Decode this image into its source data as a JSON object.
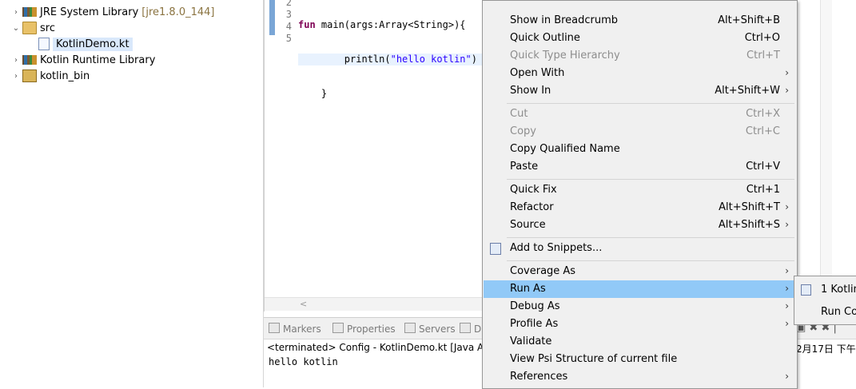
{
  "explorer": {
    "items": [
      {
        "label": "JRE System Library",
        "suffix": "[jre1.8.0_144]",
        "twisty": "›",
        "icon": "library-icon"
      },
      {
        "label": "src",
        "twisty": "⌄",
        "icon": "folder-icon"
      },
      {
        "label": "KotlinDemo.kt",
        "icon": "kotlin-file-icon",
        "selected": true
      },
      {
        "label": "Kotlin Runtime Library",
        "twisty": "›",
        "icon": "library-icon"
      },
      {
        "label": "kotlin_bin",
        "twisty": "›",
        "icon": "bin-folder-icon"
      }
    ]
  },
  "editor": {
    "line_numbers": [
      "2",
      "3",
      "4",
      "5"
    ],
    "lines": [
      {
        "kw": "fun",
        "rest": " main(args:Array<String>){"
      },
      {
        "pre": "        println(",
        "str": "\"hello kotlin\"",
        "post": ")"
      },
      {
        "text": "    }"
      },
      {
        "text": ""
      }
    ],
    "scroll_arrow": "<"
  },
  "console": {
    "tabs": [
      "Markers",
      "Properties",
      "Servers",
      "D"
    ],
    "header": "<terminated> Config - KotlinDemo.kt [Java Ap",
    "date": "2月17日 下午",
    "output": "hello kotlin",
    "tools": "▣ ✖ ✖ |"
  },
  "context_menu": {
    "items": [
      {
        "label": "Show in Breadcrumb",
        "accel": "Alt+Shift+B"
      },
      {
        "label": "Quick Outline",
        "accel": "Ctrl+O"
      },
      {
        "label": "Quick Type Hierarchy",
        "accel": "Ctrl+T",
        "disabled": true
      },
      {
        "label": "Open With",
        "submenu": true
      },
      {
        "label": "Show In",
        "accel": "Alt+Shift+W",
        "submenu": true
      },
      {
        "label": "Cut",
        "accel": "Ctrl+X",
        "disabled": true
      },
      {
        "label": "Copy",
        "accel": "Ctrl+C",
        "disabled": true
      },
      {
        "label": "Copy Qualified Name"
      },
      {
        "label": "Paste",
        "accel": "Ctrl+V"
      },
      {
        "label": "Quick Fix",
        "accel": "Ctrl+1"
      },
      {
        "label": "Refactor",
        "accel": "Alt+Shift+T",
        "submenu": true
      },
      {
        "label": "Source",
        "accel": "Alt+Shift+S",
        "submenu": true
      },
      {
        "label": "Add to Snippets...",
        "icon": "snippet-icon"
      },
      {
        "label": "Coverage As",
        "submenu": true
      },
      {
        "label": "Run As",
        "submenu": true,
        "highlighted": true
      },
      {
        "label": "Debug As",
        "submenu": true
      },
      {
        "label": "Profile As",
        "submenu": true
      },
      {
        "label": "Validate"
      },
      {
        "label": "View Psi Structure of current file"
      },
      {
        "label": "References",
        "submenu": true
      }
    ]
  },
  "submenu": {
    "items": [
      {
        "label": "1 Kotlin",
        "icon": "kotlin-app-icon"
      },
      {
        "label": "Run Co"
      }
    ]
  },
  "colors": {
    "menu_bg": "#f0f0f0",
    "menu_highlight": "#91c9f7",
    "keyword": "#7f0055",
    "string": "#2a00ff",
    "selection": "#d9e8fb"
  }
}
